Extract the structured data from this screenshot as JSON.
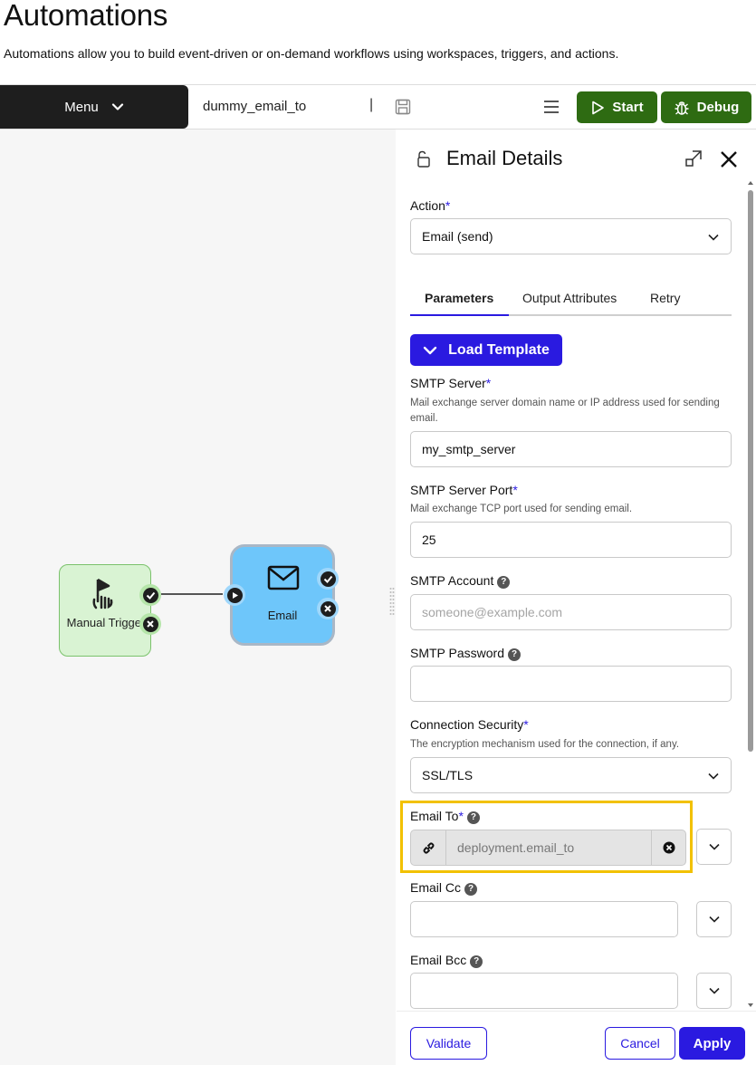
{
  "page": {
    "title": "Automations",
    "description": "Automations allow you to build event-driven or on-demand workflows using workspaces, triggers, and actions."
  },
  "toolbar": {
    "menu_label": "Menu",
    "workflow_name": "dummy_email_to",
    "cursor": "|",
    "start_label": "Start",
    "debug_label": "Debug"
  },
  "canvas": {
    "trigger_label": "Manual Trigger",
    "email_label": "Email"
  },
  "panel": {
    "title": "Email Details",
    "action_label": "Action",
    "action_value": "Email (send)",
    "tabs": [
      {
        "label": "Parameters",
        "active": true
      },
      {
        "label": "Output Attributes",
        "active": false
      },
      {
        "label": "Retry",
        "active": false
      }
    ],
    "load_template_label": "Load Template",
    "smtp_server": {
      "label": "SMTP Server",
      "hint": "Mail exchange server domain name or IP address used for sending email.",
      "value": "my_smtp_server"
    },
    "smtp_port": {
      "label": "SMTP Server Port",
      "hint": "Mail exchange TCP port used for sending email.",
      "value": "25"
    },
    "smtp_account": {
      "label": "SMTP Account",
      "placeholder": "someone@example.com",
      "value": ""
    },
    "smtp_password": {
      "label": "SMTP Password",
      "value": ""
    },
    "connection_security": {
      "label": "Connection Security",
      "hint": "The encryption mechanism used for the connection, if any.",
      "value": "SSL/TLS"
    },
    "email_to": {
      "label": "Email To",
      "value": "deployment.email_to"
    },
    "email_cc": {
      "label": "Email Cc",
      "value": ""
    },
    "email_bcc": {
      "label": "Email Bcc",
      "value": ""
    },
    "required_mark": "*",
    "help_mark": "?"
  },
  "footer": {
    "validate_label": "Validate",
    "cancel_label": "Cancel",
    "apply_label": "Apply"
  },
  "colors": {
    "primary": "#2a1ae0",
    "start_green": "#2e6b12",
    "highlight": "#f2c100",
    "trigger_bg": "#d9f3d3",
    "email_node_bg": "#6ec6fa"
  },
  "icons": [
    "chevron-down-icon",
    "save-icon",
    "hamburger-icon",
    "play-icon",
    "bug-icon",
    "unlock-icon",
    "popout-icon",
    "close-icon",
    "hand-pointer-icon",
    "mail-icon",
    "check-icon",
    "x-circle-icon",
    "link-icon"
  ]
}
